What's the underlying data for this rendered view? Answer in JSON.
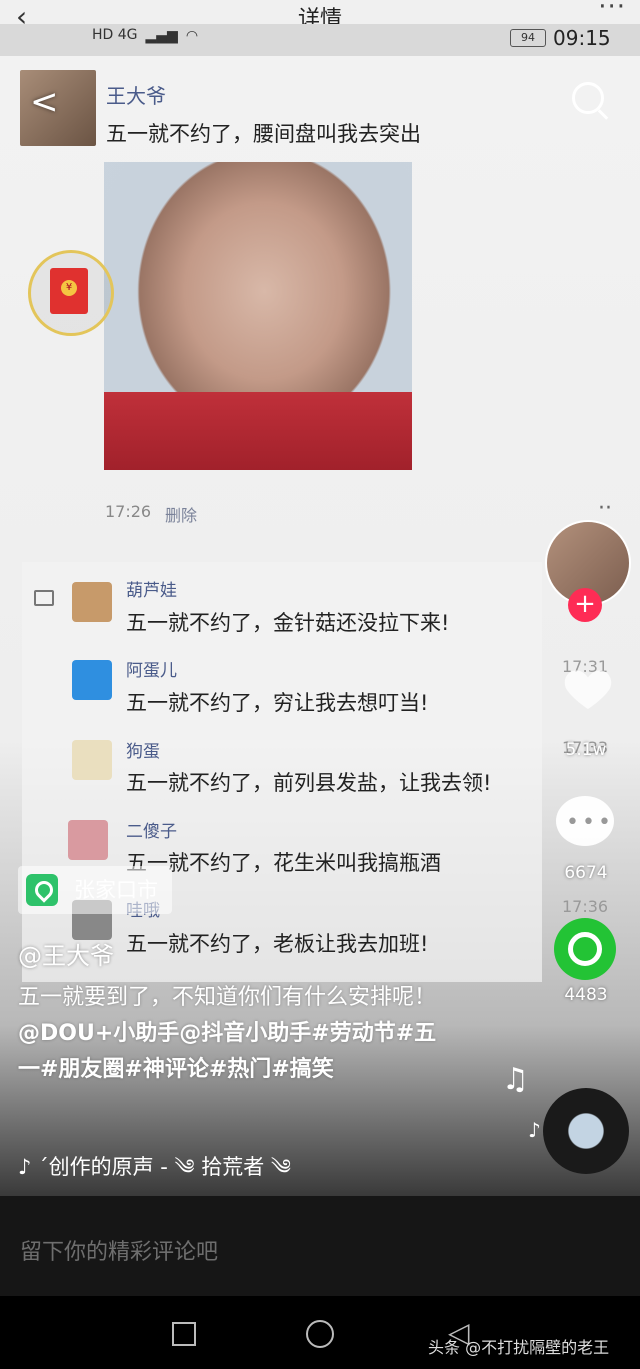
{
  "top_bar": {
    "title": "详情",
    "back_icon": "‹",
    "more_icon": "···"
  },
  "status_bar": {
    "network": "HD 4G",
    "battery": "94",
    "time": "09:15"
  },
  "post": {
    "sender_name": "王大爷",
    "message": "五一就不约了，腰间盘叫我去突出",
    "timestamp": "17:26",
    "delete_label": "删除"
  },
  "comments": [
    {
      "name": "葫芦娃",
      "text": "五一就不约了，金针菇还没拉下来!",
      "color": "#c79a6a"
    },
    {
      "name": "阿蛋儿",
      "text": "五一就不约了，穷让我去想叮当!",
      "color": "#2f8fe0",
      "time": "17:31"
    },
    {
      "name": "狗蛋",
      "text": "五一就不约了，前列县发盐，让我去领!",
      "color": "#eadfbf",
      "time": "17:33"
    },
    {
      "name": "二傻子",
      "text": "五一就不约了，花生米叫我搞瓶酒",
      "color": "#d99aa0"
    },
    {
      "name": "哇哦",
      "text": "五一就不约了，老板让我去加班!",
      "color": "#888888",
      "time": "17:36"
    }
  ],
  "rail": {
    "follow": "+",
    "like_count": "5.1w",
    "comment_count": "6674",
    "share_count": "4483"
  },
  "video": {
    "location": "张家口市",
    "author": "@王大爷",
    "description_plain": "五一就要到了，不知道你们有什么安排呢！",
    "description_tags": "@DOU+小助手@抖音小助手#劳动节#五一#朋友圈#神评论#热门#搞笑",
    "music": "´创作的原声 - ༄ 拾荒者 ༄"
  },
  "comment_input": {
    "placeholder": "留下你的精彩评论吧"
  },
  "watermark": "头条 @不打扰隔壁的老王"
}
